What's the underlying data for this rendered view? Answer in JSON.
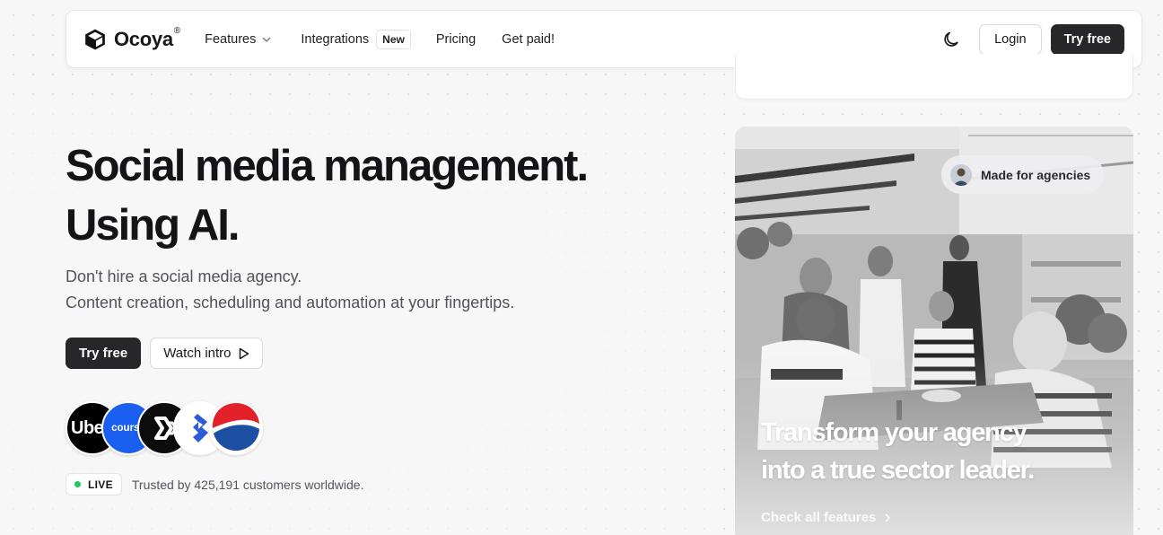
{
  "brand": {
    "name": "Ocoya",
    "reg": "®"
  },
  "nav": {
    "features": "Features",
    "integrations": "Integrations",
    "integrations_badge": "New",
    "pricing": "Pricing",
    "get_paid": "Get paid!",
    "login": "Login",
    "try_free": "Try free"
  },
  "hero": {
    "headline_line1": "Social media management.",
    "headline_line2": "Using AI.",
    "sub_line1": "Don't hire a social media agency.",
    "sub_line2": "Content creation, scheduling and automation at your fingertips.",
    "try_free": "Try free",
    "watch_intro": "Watch intro"
  },
  "logos": [
    {
      "name": "Uber",
      "text": "Uber"
    },
    {
      "name": "Course Hero",
      "text": "course"
    },
    {
      "name": "logo-fx",
      "text": ""
    },
    {
      "name": "Toptal",
      "text": ""
    },
    {
      "name": "Pepsi",
      "text": ""
    }
  ],
  "social_proof": {
    "live_label": "LIVE",
    "trusted_text": "Trusted by 425,191 customers worldwide."
  },
  "photo_card": {
    "badge": "Made for agencies",
    "title_line1": "Transform your agency",
    "title_line2": "into a true sector leader.",
    "link": "Check all features"
  },
  "colors": {
    "primary_dark": "#27272a",
    "live_green": "#22c55e",
    "background": "#f7f7f8"
  },
  "icons": {
    "brand": "cube-icon",
    "features": "chevron-down-icon",
    "theme": "moon-icon",
    "watch": "play-icon",
    "card_link": "chevron-right-icon"
  }
}
